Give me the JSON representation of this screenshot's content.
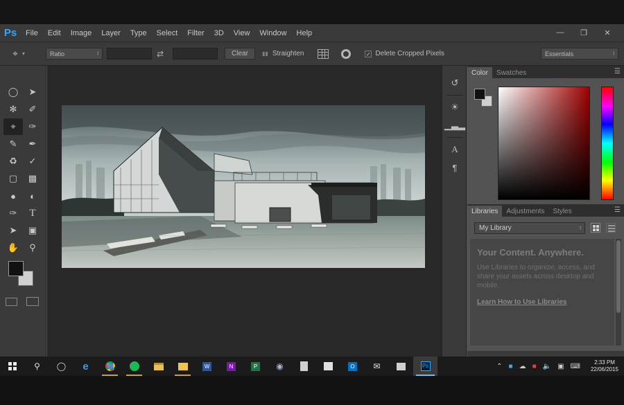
{
  "app": {
    "logo": "Ps"
  },
  "menu": [
    "File",
    "Edit",
    "Image",
    "Layer",
    "Type",
    "Select",
    "Filter",
    "3D",
    "View",
    "Window",
    "Help"
  ],
  "window_controls": [
    "minimize-icon",
    "restore-icon",
    "close-icon"
  ],
  "options_bar": {
    "tool_icon": "crop-icon",
    "ratio_select": "Ratio",
    "width_value": "",
    "height_value": "",
    "clear_label": "Clear",
    "straighten_label": "Straighten",
    "delete_cropped_label": "Delete Cropped Pixels",
    "delete_cropped_checked": true,
    "workspace": "Essentials"
  },
  "tools": [
    "marquee-icon",
    "move-icon",
    "lasso-icon",
    "quick-selection-icon",
    "crop-icon",
    "eyedropper-icon",
    "healing-brush-icon",
    "brush-icon",
    "clone-stamp-icon",
    "history-brush-icon",
    "eraser-icon",
    "gradient-icon",
    "blur-icon",
    "dodge-icon",
    "pen-icon",
    "type-icon",
    "path-selection-icon",
    "rectangle-shape-icon",
    "hand-icon",
    "zoom-icon"
  ],
  "colors": {
    "foreground": "#111111",
    "background": "#d0d0d0",
    "accent": "#31a8ff"
  },
  "color_panel": {
    "tabs": [
      "Color",
      "Swatches"
    ],
    "active_tab": "Color"
  },
  "libraries_panel": {
    "tabs": [
      "Libraries",
      "Adjustments",
      "Styles"
    ],
    "active_tab": "Libraries",
    "library_select": "My Library",
    "title": "Your Content. Anywhere.",
    "description": "Use Libraries to organize, access, and share your assets across desktop and mobile.",
    "link": "Learn How to Use Libraries"
  },
  "taskbar": {
    "apps": [
      "search-icon",
      "task-view-icon",
      "edge-icon",
      "chrome-icon",
      "spotify-icon",
      "file-explorer-icon",
      "folder-icon",
      "word-icon",
      "onenote-icon",
      "project-icon",
      "paint-icon",
      "calculator-icon",
      "store-icon",
      "outlook-icon",
      "mail-icon",
      "app-icon",
      "photoshop-icon"
    ],
    "time": "2:33 PM",
    "date": "22/06/2015"
  }
}
